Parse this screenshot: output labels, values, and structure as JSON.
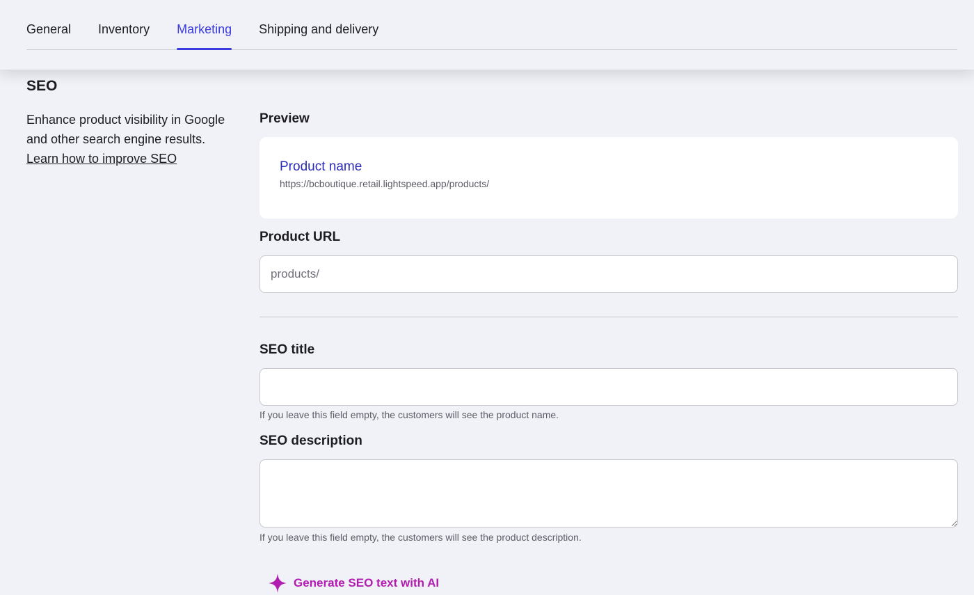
{
  "tabs": [
    {
      "label": "General",
      "active": false
    },
    {
      "label": "Inventory",
      "active": false
    },
    {
      "label": "Marketing",
      "active": true
    },
    {
      "label": "Shipping and delivery",
      "active": false
    }
  ],
  "seo": {
    "section_title": "SEO",
    "description": "Enhance product visibility in Google and other search engine results.",
    "learn_link": "Learn how to improve SEO",
    "preview": {
      "label": "Preview",
      "product_name": "Product name",
      "url": "https://bcboutique.retail.lightspeed.app/products/"
    },
    "product_url": {
      "label": "Product URL",
      "placeholder": "products/",
      "value": ""
    },
    "seo_title": {
      "label": "SEO title",
      "value": "",
      "hint": "If you leave this field empty, the customers will see the product name."
    },
    "seo_description": {
      "label": "SEO description",
      "value": "",
      "hint": "If you leave this field empty, the customers will see the product description."
    },
    "ai_button": {
      "label": "Generate SEO text with AI",
      "icon": "sparkle-icon"
    }
  },
  "colors": {
    "background": "#f1f2f7",
    "accent": "#3a3ae0",
    "preview_link": "#2b2bb8",
    "ai_magenta": "#b11cb1"
  }
}
